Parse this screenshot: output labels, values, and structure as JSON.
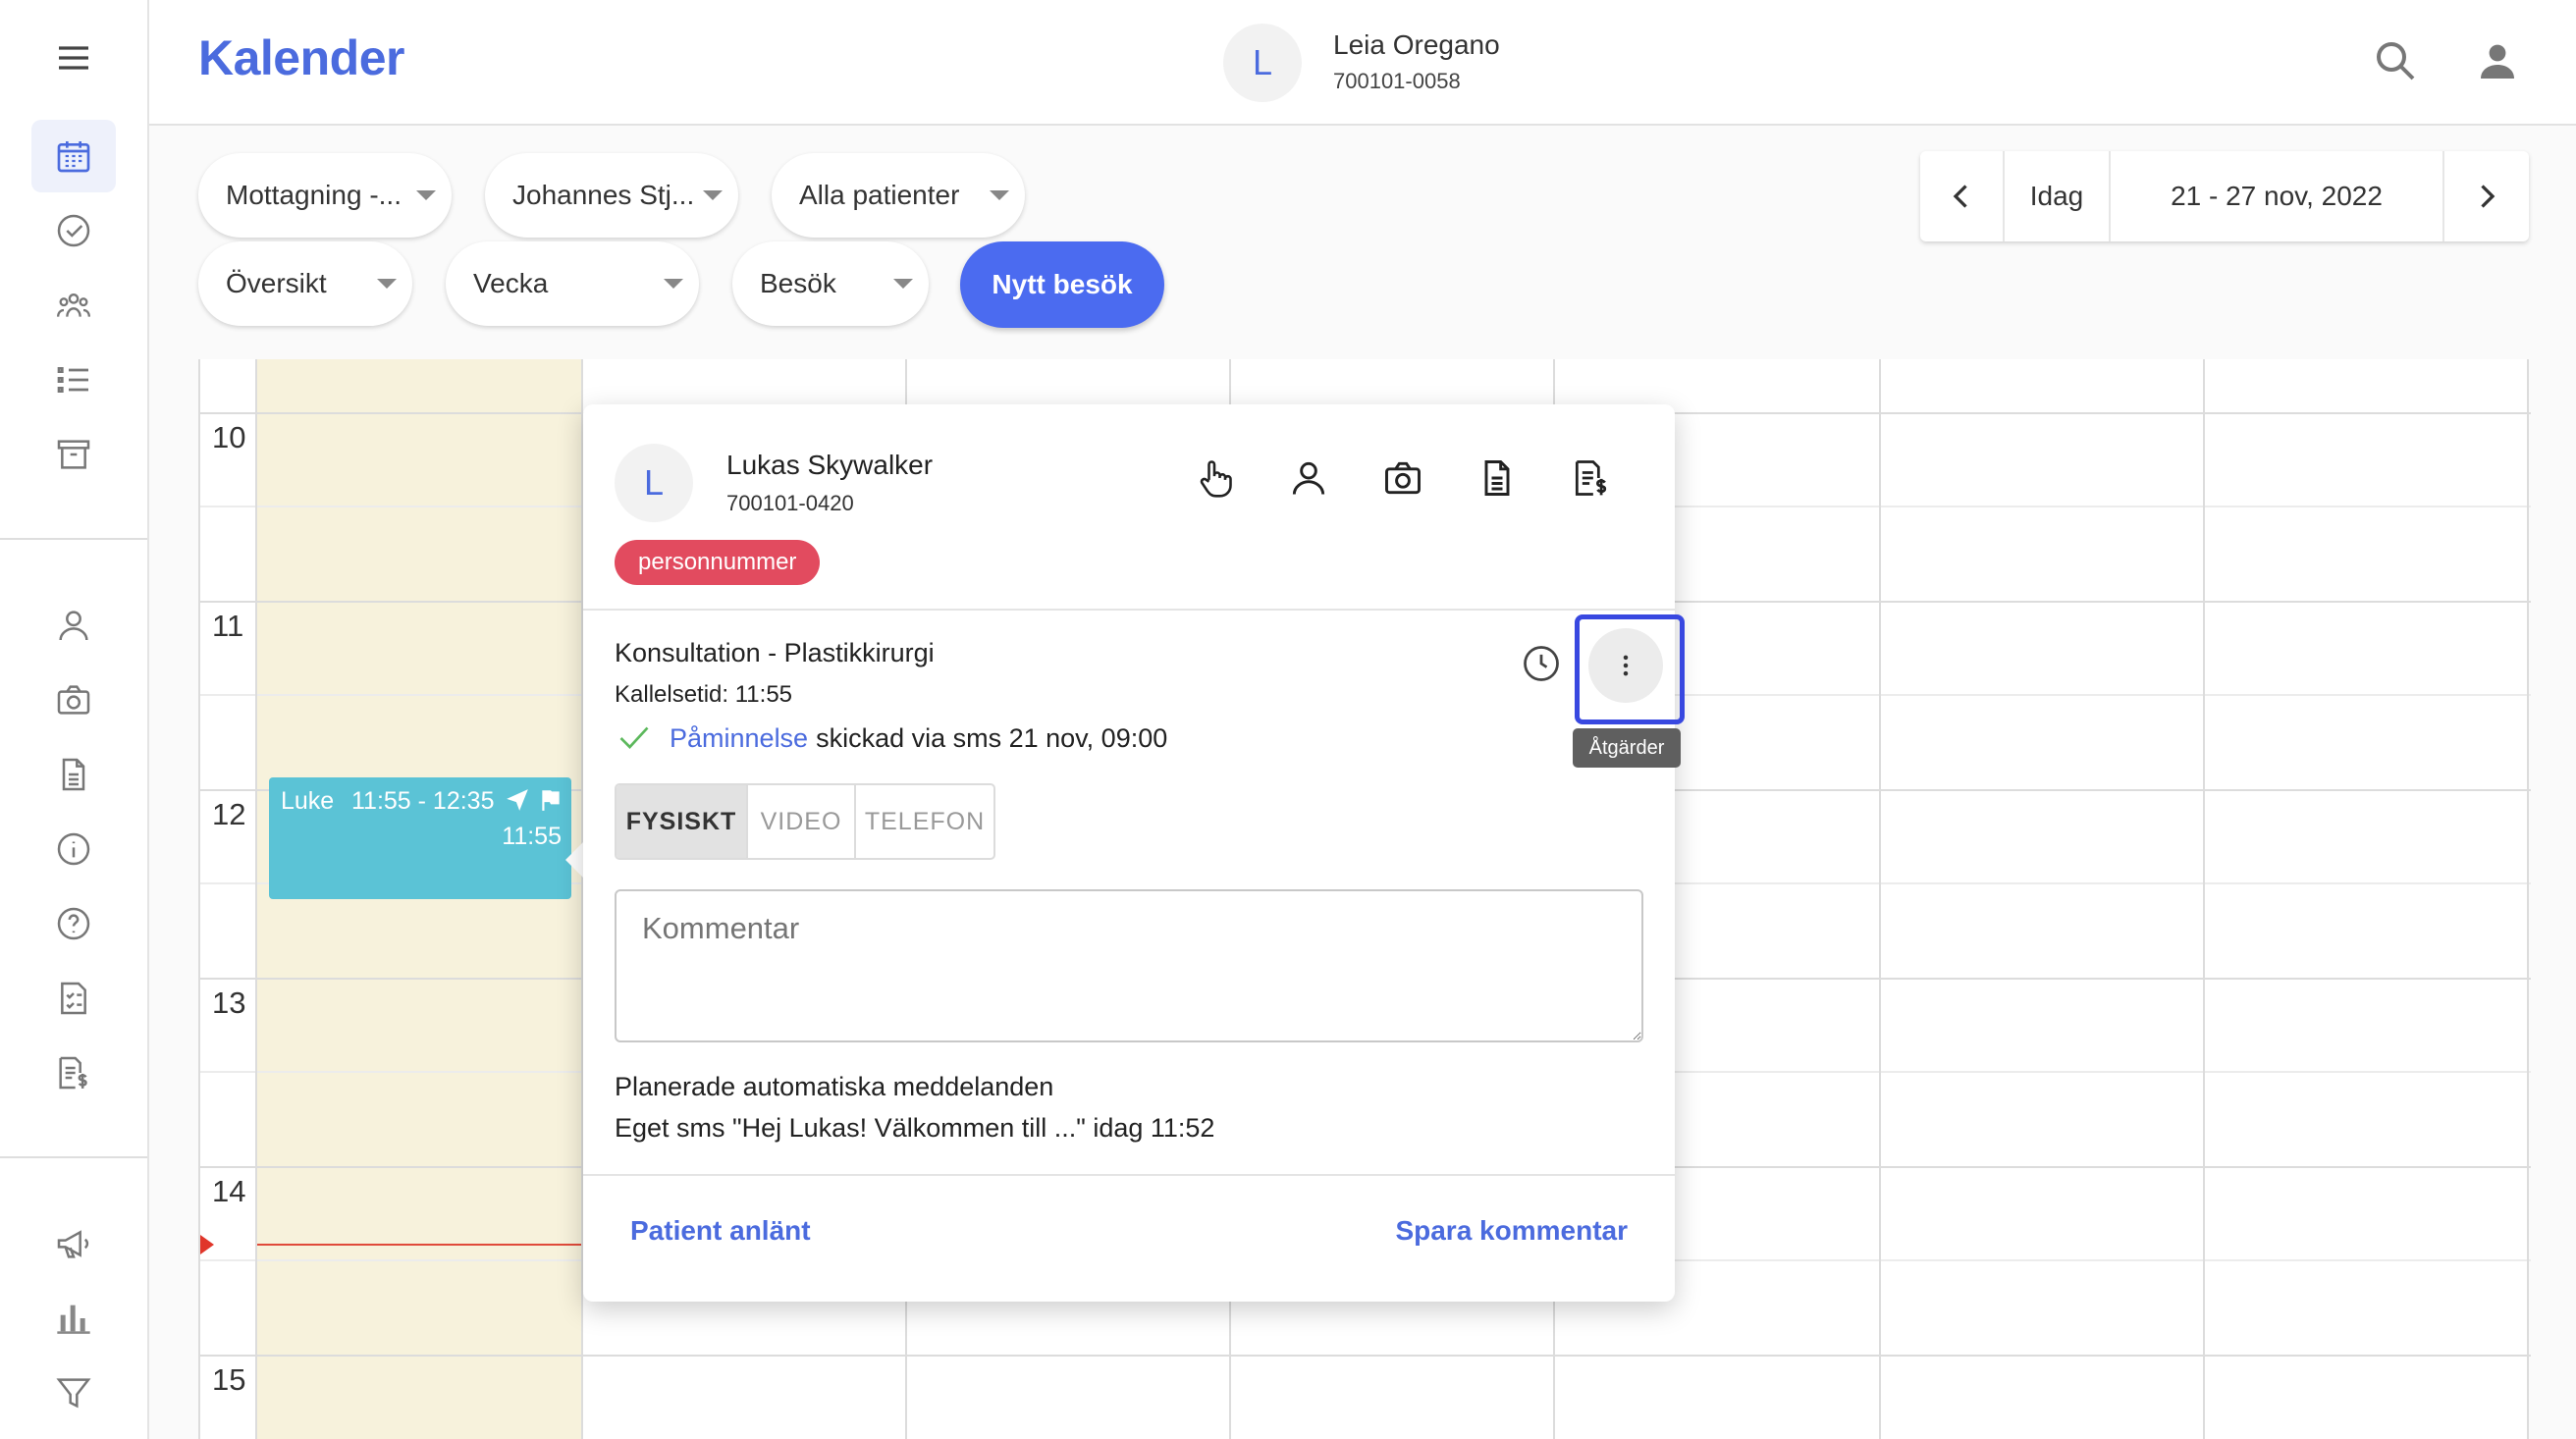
{
  "header": {
    "title": "Kalender",
    "user": {
      "initial": "L",
      "name": "Leia Oregano",
      "personnummer": "700101-0058"
    }
  },
  "sidebar": {
    "items": [
      "calendar-icon",
      "check-circle-icon",
      "group-icon",
      "list-icon",
      "archive-icon",
      "person-icon",
      "camera-icon",
      "document-icon",
      "info-icon",
      "help-icon",
      "form-icon",
      "invoice-icon",
      "megaphone-icon",
      "bar-chart-icon",
      "filter-icon"
    ],
    "active": "calendar-icon"
  },
  "filters": {
    "reception": "Mottagning -...",
    "practitioner": "Johannes Stj...",
    "patients": "Alla patienter",
    "view": "Översikt",
    "period": "Vecka",
    "type": "Besök",
    "new_visit": "Nytt besök"
  },
  "date_nav": {
    "today": "Idag",
    "range": "21 - 27 nov, 2022"
  },
  "calendar": {
    "hours": [
      "10",
      "11",
      "12",
      "13",
      "14",
      "15"
    ],
    "event": {
      "name": "Luke",
      "time": "11:55 - 12:35",
      "call_time": "11:55",
      "color": "#5bc3d6"
    },
    "today_color": "#f7f2dc"
  },
  "popup": {
    "patient": {
      "initial": "L",
      "name": "Lukas Skywalker",
      "personnummer": "700101-0420"
    },
    "badge": "personnummer",
    "badge_color": "#e24b5f",
    "visit_type": "Konsultation - Plastikkirurgi",
    "call_time": "Kallelsetid: 11:55",
    "reminder_link": "Påminnelse",
    "reminder_text": "skickad via sms 21 nov, 09:00",
    "tooltip": "Åtgärder",
    "modes": [
      "FYSISKT",
      "VIDEO",
      "TELEFON"
    ],
    "active_mode": "FYSISKT",
    "comment_placeholder": "Kommentar",
    "auto_title": "Planerade automatiska meddelanden",
    "auto_message": "Eget sms \"Hej Lukas! Välkommen till ...\" idag 11:52",
    "patient_arrived": "Patient anlänt",
    "save_comment": "Spara kommentar"
  },
  "colors": {
    "accent": "#4b6bde",
    "primary_button": "#4b6bf0",
    "highlight": "#3848e0"
  }
}
